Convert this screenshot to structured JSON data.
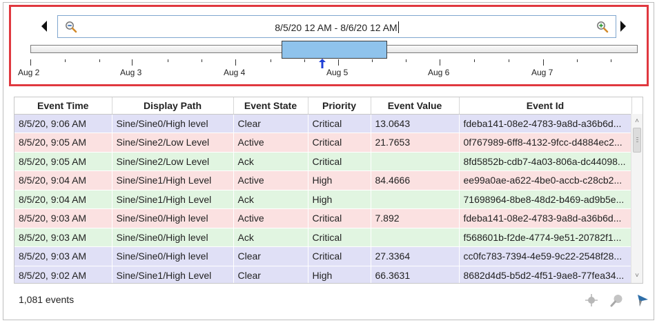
{
  "date_range": {
    "text": "8/5/20 12 AM - 8/6/20 12 AM",
    "zoom_out_icon": "zoom-out-icon",
    "zoom_in_icon": "zoom-in-icon",
    "prev_icon": "triangle-left-icon",
    "next_icon": "triangle-right-icon",
    "window_color": "#8fc3ec",
    "highlight_border_color": "#e0383f"
  },
  "timeline": {
    "labels": [
      "Aug 2",
      "Aug 3",
      "Aug 4",
      "Aug 5",
      "Aug 6",
      "Aug 7"
    ],
    "window_start": "Aug 4, 9 PM",
    "window_end": "Aug 5, 9 PM",
    "now_marker_icon": "arrow-up-icon"
  },
  "table": {
    "headers": [
      "Event Time",
      "Display Path",
      "Event State",
      "Priority",
      "Event Value",
      "Event Id"
    ],
    "rows": [
      {
        "time": "8/5/20, 9:06 AM",
        "path": "Sine/Sine0/High level",
        "state": "Clear",
        "priority": "Critical",
        "value": "13.0643",
        "id": "fdeba141-08e2-4783-9a8d-a36b6d..."
      },
      {
        "time": "8/5/20, 9:05 AM",
        "path": "Sine/Sine2/Low Level",
        "state": "Active",
        "priority": "Critical",
        "value": "21.7653",
        "id": "0f767989-6ff8-4132-9fcc-d4884ec2..."
      },
      {
        "time": "8/5/20, 9:05 AM",
        "path": "Sine/Sine2/Low Level",
        "state": "Ack",
        "priority": "Critical",
        "value": "",
        "id": "8fd5852b-cdb7-4a03-806a-dc44098..."
      },
      {
        "time": "8/5/20, 9:04 AM",
        "path": "Sine/Sine1/High Level",
        "state": "Active",
        "priority": "High",
        "value": "84.4666",
        "id": "ee99a0ae-a622-4be0-accb-c28cb2..."
      },
      {
        "time": "8/5/20, 9:04 AM",
        "path": "Sine/Sine1/High Level",
        "state": "Ack",
        "priority": "High",
        "value": "",
        "id": "71698964-8be8-48d2-b469-ad9b5e..."
      },
      {
        "time": "8/5/20, 9:03 AM",
        "path": "Sine/Sine0/High level",
        "state": "Active",
        "priority": "Critical",
        "value": "7.892",
        "id": "fdeba141-08e2-4783-9a8d-a36b6d..."
      },
      {
        "time": "8/5/20, 9:03 AM",
        "path": "Sine/Sine0/High level",
        "state": "Ack",
        "priority": "Critical",
        "value": "",
        "id": "f568601b-f2de-4774-9e51-20782f1..."
      },
      {
        "time": "8/5/20, 9:03 AM",
        "path": "Sine/Sine0/High level",
        "state": "Clear",
        "priority": "Critical",
        "value": "27.3364",
        "id": "cc0fc783-7394-4e59-9c22-2548f28..."
      },
      {
        "time": "8/5/20, 9:02 AM",
        "path": "Sine/Sine1/High Level",
        "state": "Clear",
        "priority": "High",
        "value": "66.3631",
        "id": "8682d4d5-b5d2-4f51-9ae8-77fea34..."
      }
    ],
    "state_colors": {
      "Clear": "#e0e0f6",
      "Active": "#fbe1e1",
      "Ack": "#e1f5e1"
    }
  },
  "footer": {
    "count_text": "1,081 events",
    "icons": [
      "crosshair-icon",
      "search-icon",
      "filter-icon"
    ]
  }
}
